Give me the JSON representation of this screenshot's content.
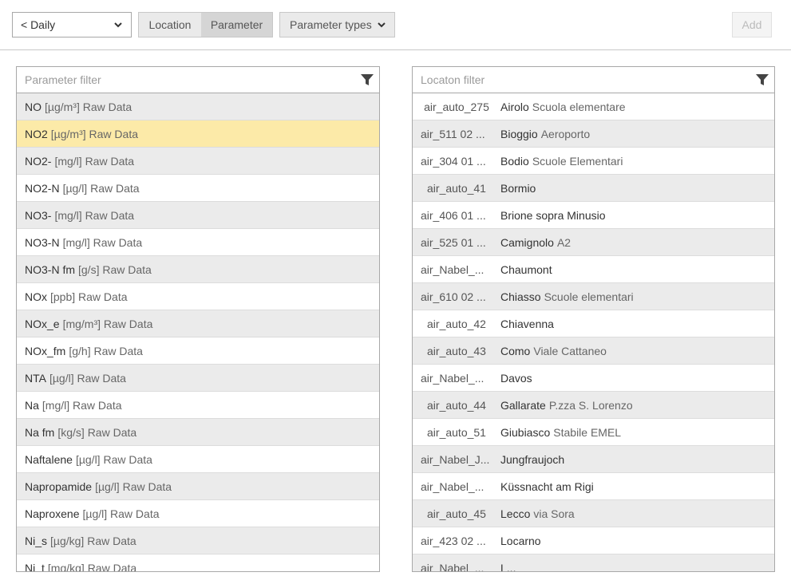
{
  "toolbar": {
    "period": "< Daily",
    "location_tab": "Location",
    "parameter_tab": "Parameter",
    "parameter_types": "Parameter types",
    "add": "Add"
  },
  "parameter_panel": {
    "filter_placeholder": "Parameter filter",
    "items": [
      {
        "name": "NO",
        "desc": "[µg/m³] Raw Data"
      },
      {
        "name": "NO2",
        "desc": "[µg/m³] Raw Data"
      },
      {
        "name": "NO2-",
        "desc": "[mg/l] Raw Data"
      },
      {
        "name": "NO2-N",
        "desc": "[µg/l] Raw Data"
      },
      {
        "name": "NO3-",
        "desc": "[mg/l] Raw Data"
      },
      {
        "name": "NO3-N",
        "desc": "[mg/l] Raw Data"
      },
      {
        "name": "NO3-N fm",
        "desc": "[g/s] Raw Data"
      },
      {
        "name": "NOx",
        "desc": "[ppb] Raw Data"
      },
      {
        "name": "NOx_e",
        "desc": "[mg/m³] Raw Data"
      },
      {
        "name": "NOx_fm",
        "desc": "[g/h] Raw Data"
      },
      {
        "name": "NTA",
        "desc": "[µg/l] Raw Data"
      },
      {
        "name": "Na",
        "desc": "[mg/l] Raw Data"
      },
      {
        "name": "Na fm",
        "desc": "[kg/s] Raw Data"
      },
      {
        "name": "Naftalene",
        "desc": "[µg/l] Raw Data"
      },
      {
        "name": "Napropamide",
        "desc": "[µg/l] Raw Data"
      },
      {
        "name": "Naproxene",
        "desc": "[µg/l] Raw Data"
      },
      {
        "name": "Ni_s",
        "desc": "[µg/kg] Raw Data"
      },
      {
        "name": "Ni_t",
        "desc": "[mg/kg] Raw Data"
      }
    ]
  },
  "location_panel": {
    "filter_placeholder": "Locaton filter",
    "items": [
      {
        "id": "air_auto_275",
        "name": "Airolo",
        "sub": "Scuola elementare"
      },
      {
        "id": "air_511 02 ...",
        "name": "Bioggio",
        "sub": "Aeroporto"
      },
      {
        "id": "air_304 01 ...",
        "name": "Bodio",
        "sub": "Scuole Elementari"
      },
      {
        "id": "air_auto_41",
        "name": "Bormio",
        "sub": ""
      },
      {
        "id": "air_406 01 ...",
        "name": "Brione sopra Minusio",
        "sub": ""
      },
      {
        "id": "air_525 01 ...",
        "name": "Camignolo",
        "sub": "A2"
      },
      {
        "id": "air_Nabel_...",
        "name": "Chaumont",
        "sub": ""
      },
      {
        "id": "air_610 02 ...",
        "name": "Chiasso",
        "sub": "Scuole elementari"
      },
      {
        "id": "air_auto_42",
        "name": "Chiavenna",
        "sub": ""
      },
      {
        "id": "air_auto_43",
        "name": "Como",
        "sub": "Viale Cattaneo"
      },
      {
        "id": "air_Nabel_...",
        "name": "Davos",
        "sub": ""
      },
      {
        "id": "air_auto_44",
        "name": "Gallarate",
        "sub": "P.zza S. Lorenzo"
      },
      {
        "id": "air_auto_51",
        "name": "Giubiasco",
        "sub": "Stabile EMEL"
      },
      {
        "id": "air_Nabel_J...",
        "name": "Jungfraujoch",
        "sub": ""
      },
      {
        "id": "air_Nabel_...",
        "name": "Küssnacht am Rigi",
        "sub": ""
      },
      {
        "id": "air_auto_45",
        "name": "Lecco",
        "sub": "via Sora"
      },
      {
        "id": "air_423 02 ...",
        "name": "Locarno",
        "sub": ""
      },
      {
        "id": "air_Nabel_...",
        "name": "L...",
        "sub": ""
      }
    ]
  },
  "colors": {
    "selected_row": "#fceaa8",
    "alt_row": "#ebebeb",
    "border": "#a8a8a8"
  },
  "icons": {
    "period_chevron": "chevron-down-icon",
    "types_chevron": "chevron-down-icon",
    "filter": "funnel-icon"
  }
}
